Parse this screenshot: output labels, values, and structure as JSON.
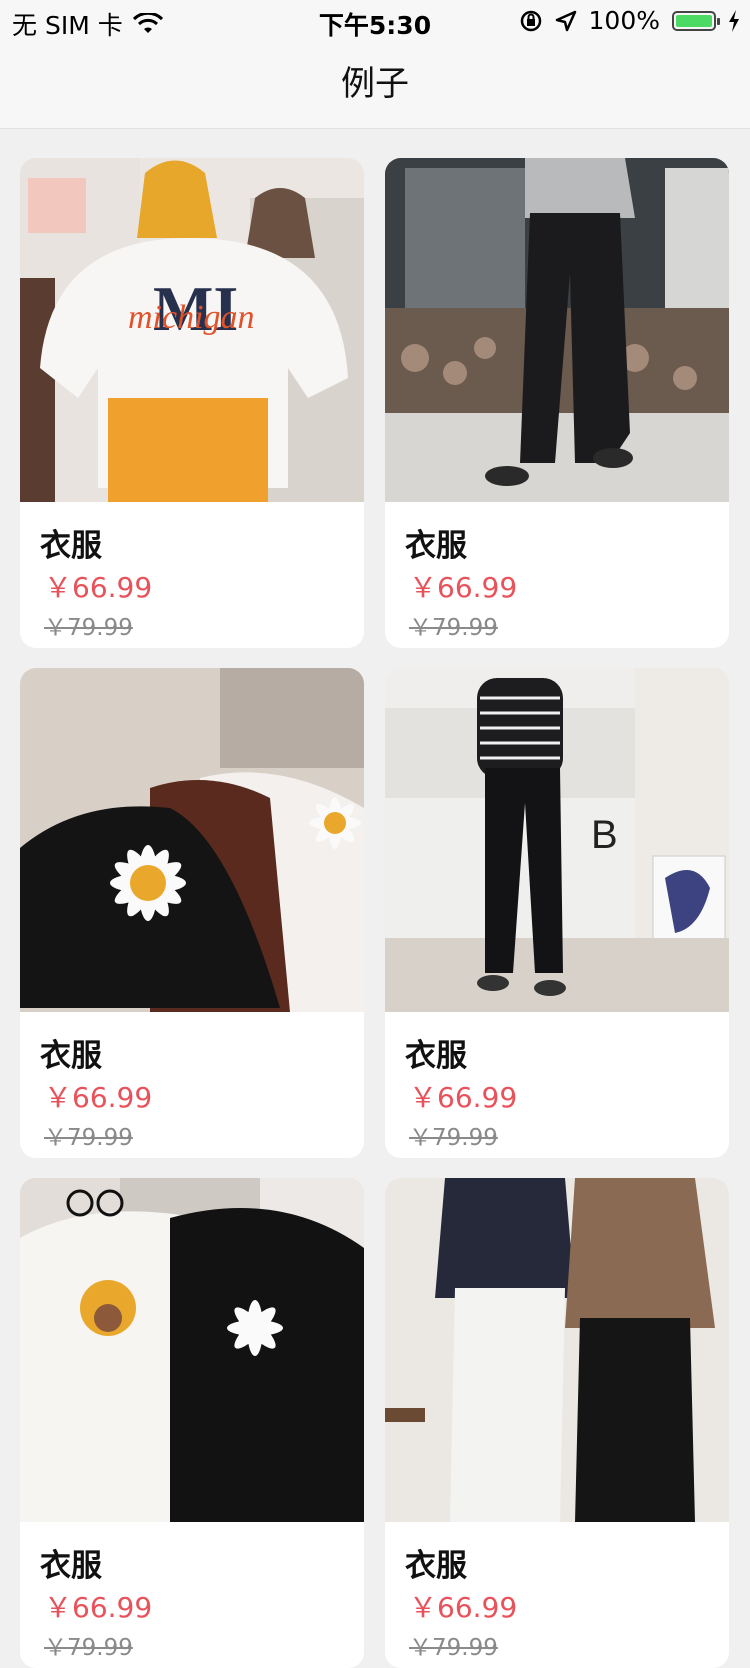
{
  "status": {
    "carrier": "无 SIM 卡",
    "time": "下午5:30",
    "battery": "100%",
    "battery_level": 1.0
  },
  "nav": {
    "title": "例子"
  },
  "products": [
    {
      "title": "衣服",
      "price": "￥66.99",
      "old_price": "￥79.99",
      "image": "white tee michigan print"
    },
    {
      "title": "衣服",
      "price": "￥66.99",
      "old_price": "￥79.99",
      "image": "black wide pants"
    },
    {
      "title": "衣服",
      "price": "￥66.99",
      "old_price": "￥79.99",
      "image": "daisy print tees"
    },
    {
      "title": "衣服",
      "price": "￥66.99",
      "old_price": "￥79.99",
      "image": "striped top black pants"
    },
    {
      "title": "衣服",
      "price": "￥66.99",
      "old_price": "￥79.99",
      "image": "daisy tees pair"
    },
    {
      "title": "衣服",
      "price": "￥66.99",
      "old_price": "￥79.99",
      "image": "white jeans model"
    }
  ],
  "colors": {
    "accent_price": "#e8535b",
    "old_price": "#8a8a8a",
    "battery": "#4cd964"
  }
}
